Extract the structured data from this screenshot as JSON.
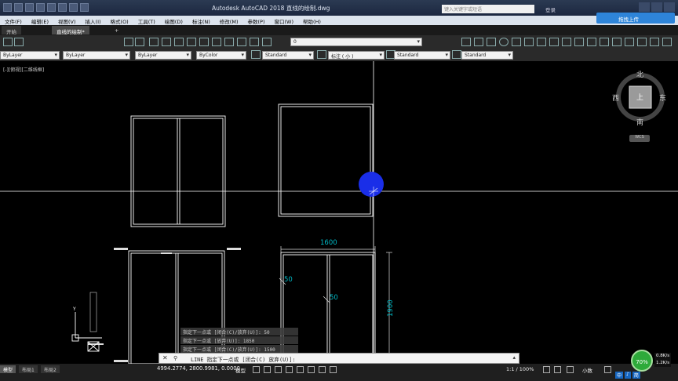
{
  "window": {
    "title": "Autodesk AutoCAD 2018    直线的绘制.dwg",
    "search_placeholder": "键入关键字或短语",
    "user_label": "登录"
  },
  "baidu": {
    "label": "拖拽上传"
  },
  "menu": [
    "文件(F)",
    "编辑(E)",
    "视图(V)",
    "插入(I)",
    "格式(O)",
    "工具(T)",
    "绘图(D)",
    "标注(N)",
    "修改(M)",
    "参数(P)",
    "窗口(W)",
    "帮助(H)"
  ],
  "tabs": {
    "start": "开始",
    "doc": "直线的绘制*",
    "add": "+"
  },
  "toolbar": {
    "layer_value": "0",
    "color": "ByLayer",
    "linetype": "ByLayer",
    "lineweight": "ByLayer",
    "plotstyle": "ByColor",
    "textstyle": "Standard",
    "dimstyle": "标注 ( 小 )",
    "tablestyle": "Standard",
    "mleaderstyle": "Standard"
  },
  "viewport": {
    "label": "[-][俯视][二维线框]"
  },
  "viewcube": {
    "north": "北",
    "south": "南",
    "east": "东",
    "west": "西",
    "top": "上",
    "wcs": "WCS"
  },
  "drawing": {
    "dim_width": "1600",
    "dim_height": "1900",
    "dim_50_a": "50",
    "dim_50_b": "50"
  },
  "command": {
    "history": [
      "指定下一点或 [闭合(C)/放弃(U)]: 50",
      "指定下一点或 [放弃(U)]: 1850",
      "指定下一点或 [闭合(C)/放弃(U)]: 1500"
    ],
    "prompt": "LINE 指定下一点或 [闭合(C) 放弃(U)]:"
  },
  "status": {
    "model_tab": "模型",
    "layout1": "布局1",
    "layout2": "布局2",
    "coords": "4994.2774, 2800.9981, 0.0000",
    "model_btn": "模型",
    "scale": "1:1 / 100%",
    "units": "小数"
  },
  "tray": {
    "perf": "70%",
    "net_up": "0.8K/s",
    "net_down": "1.2K/s",
    "ime": [
      "中",
      "♪",
      "简"
    ]
  },
  "colors": {
    "canvas": "#000000",
    "crosshair": "#ffffff",
    "dimension": "#00b7c3",
    "cursor_blob": "#1a2ee8"
  }
}
